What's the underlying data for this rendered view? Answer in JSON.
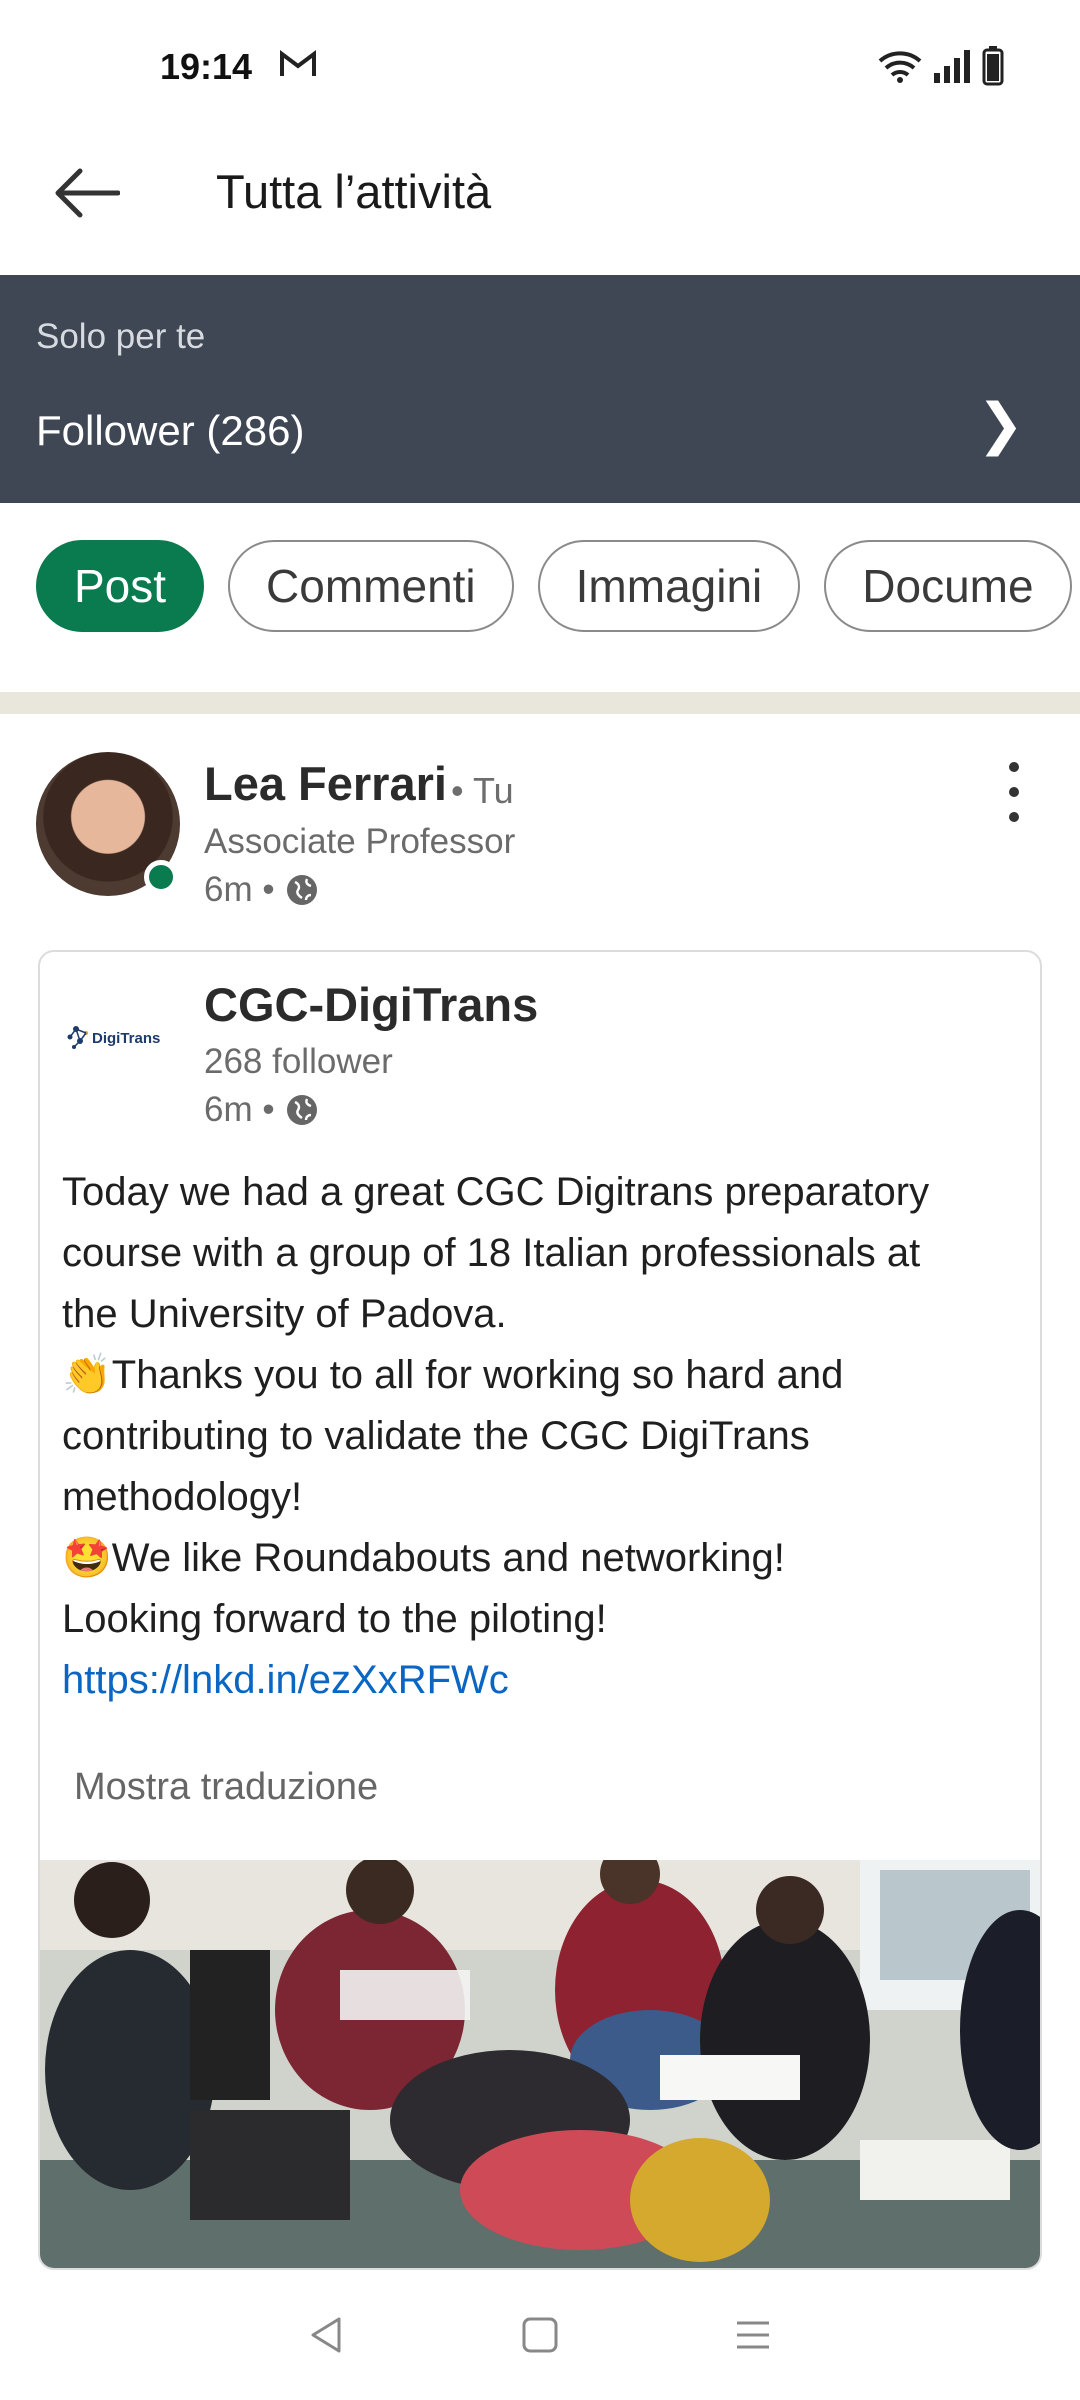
{
  "status_bar": {
    "time": "19:14"
  },
  "header": {
    "title": "Tutta l’attività"
  },
  "banner": {
    "subtitle": "Solo per te",
    "title": "Follower (286)"
  },
  "filters": [
    {
      "label": "Post",
      "active": true
    },
    {
      "label": "Commenti",
      "active": false
    },
    {
      "label": "Immagini",
      "active": false
    },
    {
      "label": "Docume",
      "active": false
    }
  ],
  "post": {
    "author": {
      "name": "Lea Ferrari",
      "relation": "• Tu",
      "headline": "Associate Professor",
      "time": "6m •"
    },
    "shared": {
      "org_name": "CGC-DigiTrans",
      "followers": "268 follower",
      "time": "6m •",
      "logo_text": "DigiTrans",
      "lines": [
        "Today we had a great CGC Digitrans preparatory",
        "course with a group of 18 Italian professionals at",
        "the University of Padova.",
        "👏Thanks you to all for working so hard and",
        "contributing to validate the CGC DigiTrans",
        "methodology!",
        "🤩We like Roundabouts and networking!",
        "Looking forward to the piloting!"
      ],
      "link": "https://lnkd.in/ezXxRFWc",
      "translate_label": "Mostra traduzione"
    }
  },
  "colors": {
    "accent_green": "#0a7a4f",
    "banner_bg": "#3e4753",
    "link": "#0a66c2"
  }
}
